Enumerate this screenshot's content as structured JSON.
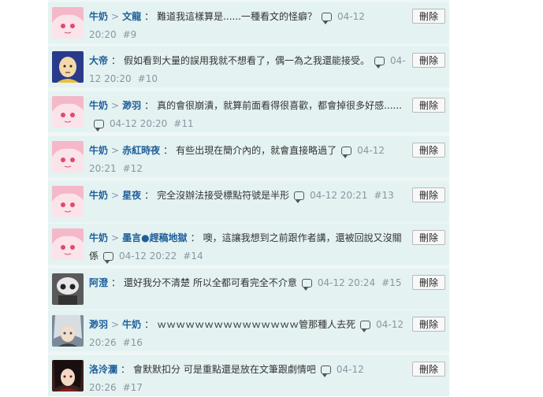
{
  "comments": [
    {
      "avatar": "anime-girl-pink",
      "user": "牛奶",
      "target": "文龍",
      "text": "難道我這樣算是......一種看文的怪癖？",
      "date": "04-12 20:20",
      "num": "#9",
      "delete": "刪除"
    },
    {
      "avatar": "bald-hero",
      "user": "大帝",
      "target": "",
      "text": "假如看到大量的誤用我就不想看了，偶一為之我還能接受。",
      "date": "04-12 20:20",
      "num": "#10",
      "delete": "刪除"
    },
    {
      "avatar": "anime-girl-pink",
      "user": "牛奶",
      "target": "渺羽",
      "text": "真的會很崩潰，就算前面看得很喜歡，都會掉很多好感......",
      "date": "04-12 20:20",
      "num": "#11",
      "delete": "刪除"
    },
    {
      "avatar": "anime-girl-pink",
      "user": "牛奶",
      "target": "赤紅時夜",
      "text": "有些出現在簡介內的，就會直接略過了",
      "date": "04-12 20:21",
      "num": "#12",
      "delete": "刪除"
    },
    {
      "avatar": "anime-girl-pink",
      "user": "牛奶",
      "target": "星夜",
      "text": "完全沒辦法接受標點符號是半形",
      "date": "04-12 20:21",
      "num": "#13",
      "delete": "刪除"
    },
    {
      "avatar": "anime-girl-pink",
      "user": "牛奶",
      "target": "墨言●趕稿地獄",
      "text": "噢，這讓我想到之前跟作者講，還被回說又沒關係",
      "date": "04-12 20:22",
      "num": "#14",
      "delete": "刪除"
    },
    {
      "avatar": "robot-helmet",
      "user": "阿澄",
      "target": "",
      "text": "還好我分不清楚 所以全都可看完全不介意",
      "date": "04-12 20:24",
      "num": "#15",
      "delete": "刪除"
    },
    {
      "avatar": "silver-hair",
      "user": "渺羽",
      "target": "牛奶",
      "text": "ｗｗｗｗｗｗｗｗｗｗｗｗｗｗｗ管那種人去死",
      "date": "04-12 20:26",
      "num": "#16",
      "delete": "刪除"
    },
    {
      "avatar": "dark-hair",
      "user": "洛泠瀾",
      "target": "",
      "text": "會默默扣分 可是重點還是放在文筆跟劇情吧",
      "date": "04-12 20:26",
      "num": "#17",
      "delete": "刪除"
    }
  ]
}
